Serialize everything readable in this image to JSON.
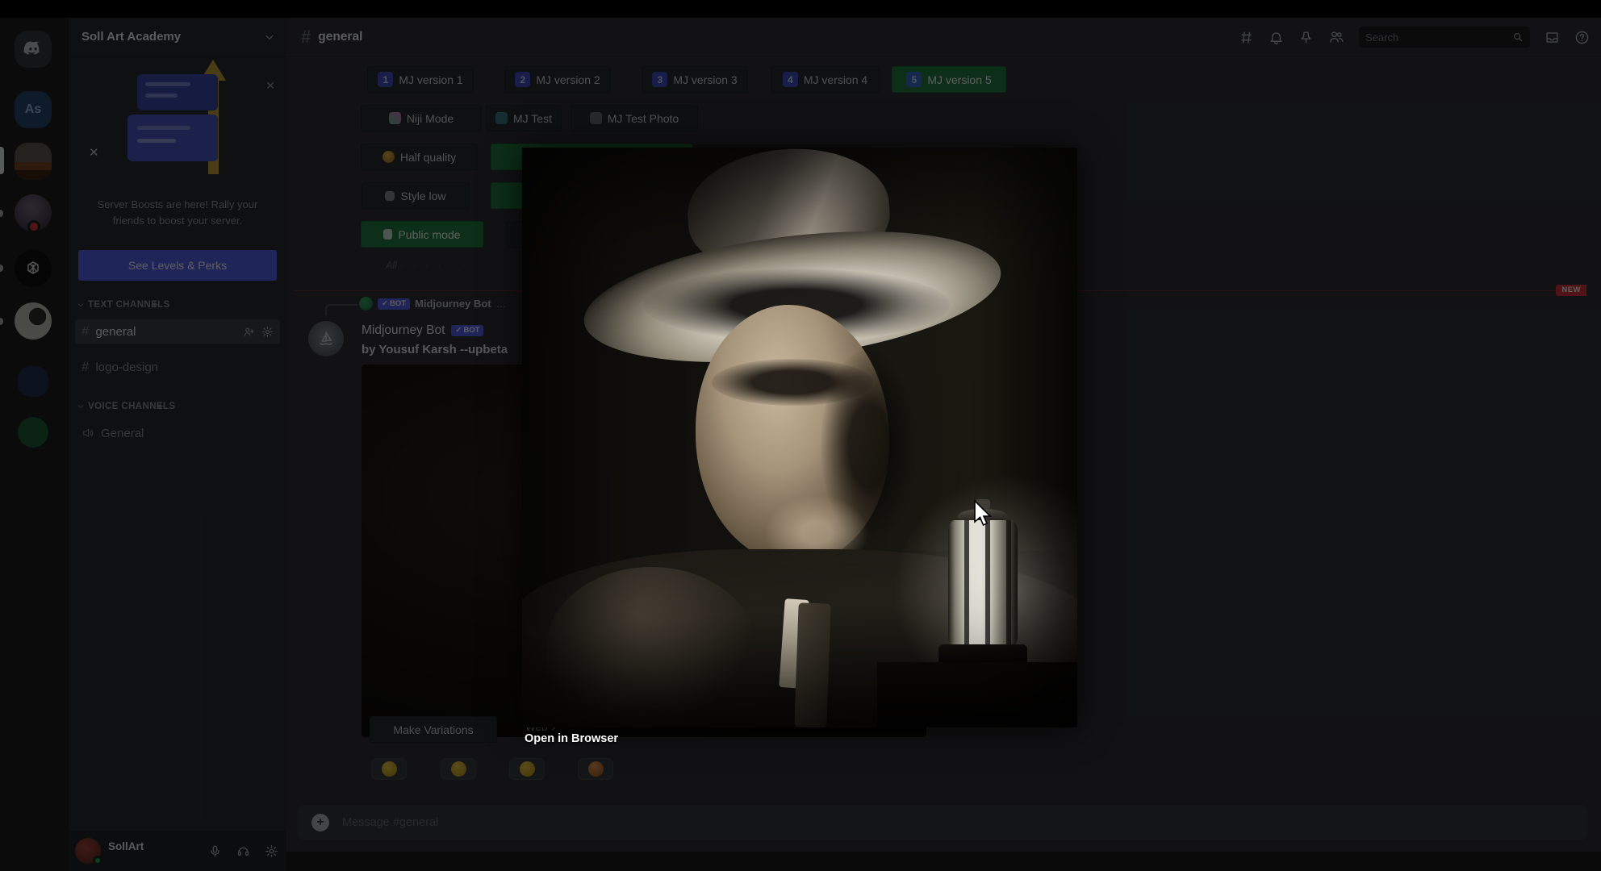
{
  "window": {
    "title": "Discord"
  },
  "rail": {
    "as_label": "As",
    "servers": [
      "discord-home",
      "server-as",
      "art-academy-selected",
      "wizard-avatar",
      "chatgpt",
      "moon-sketch",
      "blue-server",
      "green-server"
    ]
  },
  "sidebar": {
    "server_name": "Soll Art Academy",
    "boost": {
      "message": "Server Boosts are here! Rally your friends to boost your server.",
      "cta": "See Levels & Perks",
      "close_icon": "✕",
      "sparkle": "✕"
    },
    "text_channels_label": "TEXT CHANNELS",
    "voice_channels_label": "VOICE CHANNELS",
    "add_channel": "+",
    "channels": [
      {
        "name": "general",
        "selected": true
      },
      {
        "name": "logo-design",
        "selected": false
      }
    ],
    "voice_channels": [
      {
        "name": "General"
      }
    ],
    "user": {
      "name": "SollArt"
    }
  },
  "header": {
    "channel": "general",
    "hash": "#",
    "search_placeholder": "Search",
    "icons": [
      "threads-icon",
      "bell-icon",
      "pin-icon",
      "members-icon",
      "inbox-icon",
      "help-icon"
    ]
  },
  "settings": {
    "row1": [
      {
        "num": "1",
        "label": "MJ version 1"
      },
      {
        "num": "2",
        "label": "MJ version 2"
      },
      {
        "num": "3",
        "label": "MJ version 3"
      },
      {
        "num": "4",
        "label": "MJ version 4"
      },
      {
        "num": "5",
        "label": "MJ version 5",
        "active": true
      }
    ],
    "row2": [
      {
        "label": "Niji Mode"
      },
      {
        "label": "MJ Test"
      },
      {
        "label": "MJ Test Photo"
      }
    ],
    "row3": [
      {
        "label": "Half quality"
      }
    ],
    "row4": [
      {
        "label": "Style low"
      }
    ],
    "row5": [
      {
        "label": "Public mode"
      }
    ]
  },
  "chat": {
    "footer_note": "All",
    "new_badge": "NEW",
    "reply": {
      "author": "Midjourney Bot",
      "bot_badge": "BOT",
      "bot_check": "✓"
    },
    "message": {
      "author": "Midjourney Bot",
      "bot_badge": "BOT",
      "bot_check": "✓",
      "content": "by Yousuf Karsh --upbeta"
    },
    "actions": {
      "make_variations": "Make Variations",
      "web": "Web ↗"
    },
    "reactions": [
      "smile-emoji",
      "grin-emoji",
      "wink-emoji",
      "clap-emoji"
    ],
    "input_placeholder": "Message #general",
    "plus": "+"
  },
  "lightbox": {
    "link": "Open in Browser"
  },
  "colors": {
    "blurple": "#5865f2",
    "green": "#248046",
    "red": "#da373c",
    "scrim": "rgba(0,0,0,0.63)"
  }
}
